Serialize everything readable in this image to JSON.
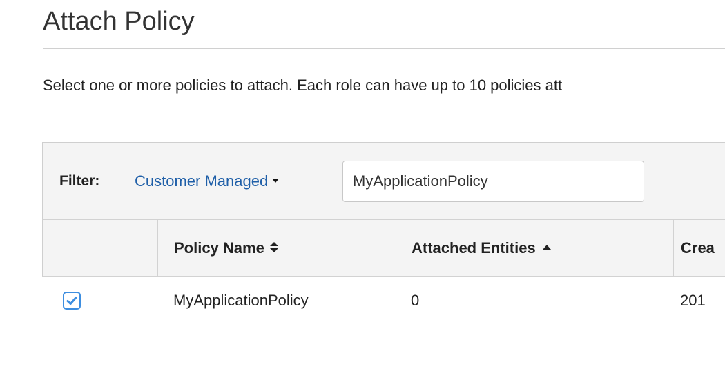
{
  "page": {
    "title": "Attach Policy",
    "description": "Select one or more policies to attach. Each role can have up to 10 policies att"
  },
  "filter": {
    "label": "Filter:",
    "type_label": "Customer Managed",
    "search_value": "MyApplicationPolicy"
  },
  "table": {
    "columns": [
      {
        "label": "Policy Name"
      },
      {
        "label": "Attached Entities"
      },
      {
        "label": "Crea"
      }
    ],
    "rows": [
      {
        "checked": true,
        "policy_name": "MyApplicationPolicy",
        "attached_entities": "0",
        "created": "201"
      }
    ]
  },
  "icons": {
    "filter_type_dropdown": "caret-down-icon",
    "policy_name_sort": "sort-both-icon",
    "attached_entities_sort": "sort-ascending-icon",
    "row_checkbox": "checkmark-icon"
  },
  "colors": {
    "link": "#1f5fa8",
    "checkbox_accent": "#3d8ee0",
    "header_background": "#f4f4f4",
    "border": "#d2d2d2"
  }
}
